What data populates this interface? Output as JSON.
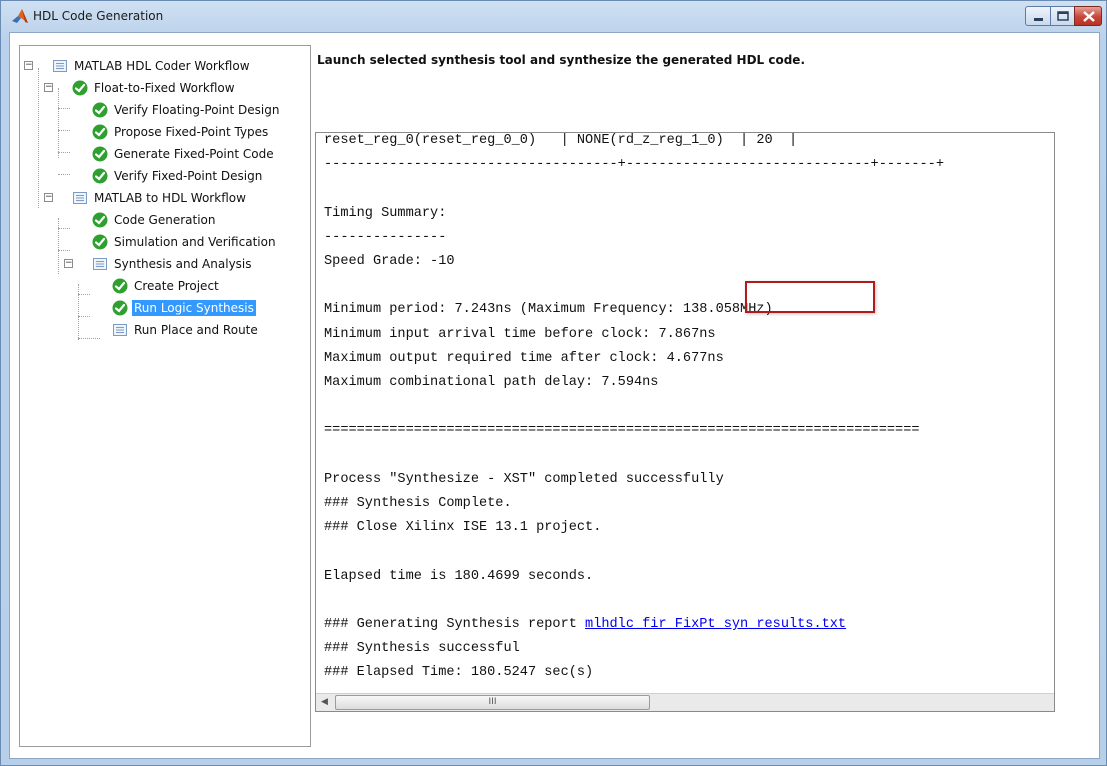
{
  "window": {
    "title": "HDL Code Generation",
    "icon": "matlab-logo-icon"
  },
  "tree": {
    "items": [
      {
        "label": "MATLAB HDL Coder Workflow",
        "icon": "workflow-list-icon",
        "expander": "−"
      },
      {
        "label": "Float-to-Fixed Workflow",
        "icon": "check-circle-icon",
        "expander": "−"
      },
      {
        "label": "Verify Floating-Point Design",
        "icon": "check-circle-icon"
      },
      {
        "label": "Propose Fixed-Point Types",
        "icon": "check-circle-icon"
      },
      {
        "label": "Generate Fixed-Point Code",
        "icon": "check-circle-icon"
      },
      {
        "label": "Verify Fixed-Point Design",
        "icon": "check-circle-icon"
      },
      {
        "label": "MATLAB to HDL Workflow",
        "icon": "workflow-list-icon",
        "expander": "−"
      },
      {
        "label": "Code Generation",
        "icon": "check-circle-icon"
      },
      {
        "label": "Simulation and Verification",
        "icon": "check-circle-icon"
      },
      {
        "label": "Synthesis and Analysis",
        "icon": "workflow-list-icon",
        "expander": "−"
      },
      {
        "label": "Create Project",
        "icon": "check-circle-icon"
      },
      {
        "label": "Run Logic Synthesis",
        "icon": "check-circle-icon",
        "selected": true
      },
      {
        "label": "Run Place and Route",
        "icon": "workflow-list-icon"
      }
    ]
  },
  "main": {
    "heading": "Launch selected synthesis tool and synthesize the generated HDL code."
  },
  "log": {
    "lines": [
      "reset_reg_0(reset_reg_0_0)   | NONE(rd_z_reg_1_0)  | 20  |",
      "------------------------------------+------------------------------+-------+",
      "",
      "Timing Summary:",
      "---------------",
      "Speed Grade: -10",
      "",
      "Minimum period: 7.243ns (Maximum Frequency: 138.058MHz)",
      "Minimum input arrival time before clock: 7.867ns",
      "Maximum output required time after clock: 4.677ns",
      "Maximum combinational path delay: 7.594ns",
      "",
      "=========================================================================",
      "",
      "Process \"Synthesize - XST\" completed successfully",
      "### Synthesis Complete.",
      "### Close Xilinx ISE 13.1 project.",
      "",
      "Elapsed time is 180.4699 seconds.",
      "",
      "### Generating Synthesis report ",
      "### Synthesis successful",
      "### Elapsed Time: 180.5247 sec(s)"
    ],
    "link_text": "mlhdlc_fir_FixPt_syn_results.txt",
    "scroll_thumb_grip": "III",
    "scroll_left_arrow": "◀"
  },
  "colors": {
    "selection": "#3399ff",
    "check_green": "#2fa02f",
    "highlight_border": "#b01c1c",
    "link": "#0000ee"
  }
}
